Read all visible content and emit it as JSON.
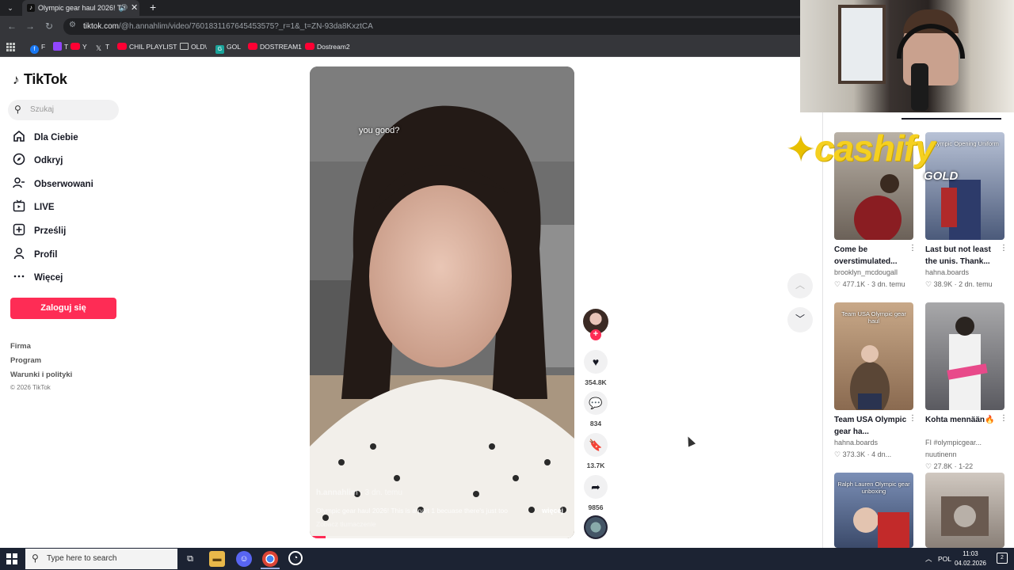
{
  "browser": {
    "tab_title": "Olympic gear haul 2026! Th",
    "tab_favicon": "tiktok-icon",
    "url_host": "tiktok.com",
    "url_path": "/@h.annahlim/video/7601831167645453575?_r=1&_t=ZN-93da8KxztCA",
    "bookmarks": [
      {
        "label": "F",
        "icon": "facebook-icon"
      },
      {
        "label": "T",
        "icon": "twitch-icon"
      },
      {
        "label": "Y",
        "icon": "youtube-icon"
      },
      {
        "label": "T",
        "icon": "x-icon"
      },
      {
        "label": "CHIL PLAYLIST",
        "icon": "youtube-icon"
      },
      {
        "label": "OLD\\",
        "icon": "folder-icon"
      },
      {
        "label": "GOL",
        "icon": "g-icon"
      },
      {
        "label": "DOSTREAM1",
        "icon": "youtube-icon"
      },
      {
        "label": "Dostream2",
        "icon": "youtube-icon"
      }
    ]
  },
  "sidebar": {
    "logo": "TikTok",
    "search_placeholder": "Szukaj",
    "items": [
      {
        "label": "Dla Ciebie",
        "icon": "home-icon"
      },
      {
        "label": "Odkryj",
        "icon": "compass-icon"
      },
      {
        "label": "Obserwowani",
        "icon": "following-icon"
      },
      {
        "label": "LIVE",
        "icon": "live-icon"
      },
      {
        "label": "Prześlij",
        "icon": "upload-icon"
      },
      {
        "label": "Profil",
        "icon": "profile-icon"
      },
      {
        "label": "Więcej",
        "icon": "more-icon"
      }
    ],
    "login_label": "Zaloguj się",
    "footer_links": [
      "Firma",
      "Program",
      "Warunki i polityki"
    ],
    "copyright": "© 2026 TikTok"
  },
  "video": {
    "overlay_text": "you good?",
    "username": "h.annahlim",
    "age": "· 3 dn. temu",
    "description": "Olympic gear haul 2026! This is a part 1 becuase there's just too",
    "more_label": "więcej",
    "translate_label": "Zobacz tłumaczenie",
    "progress": 0.06
  },
  "actions": {
    "likes": "354.8K",
    "comments": "834",
    "saves": "13.7K",
    "shares": "9856"
  },
  "recommended": [
    {
      "title": "Come be overstimulated...",
      "author": "brooklyn_mcdougall",
      "views": "477.1K",
      "age": "3 dn. temu",
      "thumb_text": "",
      "thumb_color": "#6b6158"
    },
    {
      "title": "Last but not least the unis. Thank...",
      "author": "hahna.boards",
      "views": "38.9K",
      "age": "2 dn. temu",
      "thumb_text": "Olympic Opening Uniform",
      "thumb_color": "#4b5a7a"
    },
    {
      "title": "Team USA Olympic gear ha...",
      "author": "hahna.boards",
      "views": "373.3K",
      "age": "4 dn...",
      "thumb_text": "Team USA Olympic gear haul",
      "thumb_color": "#8a6a50"
    },
    {
      "title": "Kohta mennään🔥",
      "author": "FI #olympicgear...",
      "author2": "nuutinenn",
      "views": "27.8K",
      "age": "1-22",
      "thumb_text": "",
      "thumb_color": "#5a5a60"
    },
    {
      "title": "",
      "author": "",
      "views": "",
      "age": "",
      "thumb_text": "Ralph Lauren Olympic gear unboxing",
      "thumb_color": "#3b4a6a"
    },
    {
      "title": "",
      "author": "",
      "views": "",
      "age": "",
      "thumb_text": "",
      "thumb_color": "#8a8078"
    }
  ],
  "overlay_brand": "cashify",
  "overlay_brand_sub": "GOLD",
  "taskbar": {
    "search_placeholder": "Type here to search",
    "lang": "POL",
    "time": "11:03",
    "date": "04.02.2026"
  },
  "colors": {
    "accent": "#fe2c55",
    "brand_overlay": "#f5d020"
  }
}
